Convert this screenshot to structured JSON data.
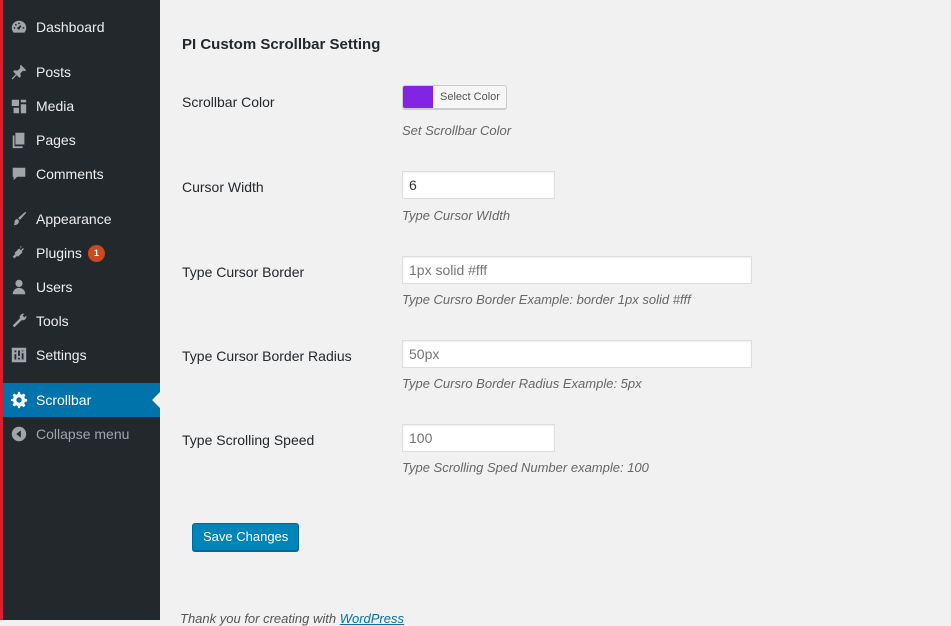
{
  "sidebar": {
    "items": [
      {
        "label": "Dashboard",
        "icon": "dashboard-icon"
      },
      {
        "label": "Posts",
        "icon": "pin-icon"
      },
      {
        "label": "Media",
        "icon": "media-icon"
      },
      {
        "label": "Pages",
        "icon": "pages-icon"
      },
      {
        "label": "Comments",
        "icon": "comment-icon"
      },
      {
        "label": "Appearance",
        "icon": "paintbrush-icon"
      },
      {
        "label": "Plugins",
        "icon": "plug-icon",
        "badge": "1"
      },
      {
        "label": "Users",
        "icon": "user-icon"
      },
      {
        "label": "Tools",
        "icon": "wrench-icon"
      },
      {
        "label": "Settings",
        "icon": "sliders-icon"
      },
      {
        "label": "Scrollbar",
        "icon": "gear-icon",
        "active": true
      },
      {
        "label": "Collapse menu",
        "icon": "collapse-arrow-icon"
      }
    ]
  },
  "page": {
    "title": "PI Custom Scrollbar Setting",
    "fields": {
      "color": {
        "label": "Scrollbar Color",
        "button_label": "Select Color",
        "value": "#8224e3",
        "description": "Set Scrollbar Color"
      },
      "width": {
        "label": "Cursor Width",
        "value": "6",
        "description": "Type Cursor WIdth"
      },
      "border": {
        "label": "Type Cursor Border",
        "placeholder": "1px solid #fff",
        "description": "Type Cursro Border Example: border 1px solid #fff"
      },
      "radius": {
        "label": "Type Cursor Border Radius",
        "placeholder": "50px",
        "description": "Type Cursro Border Radius Example: 5px"
      },
      "speed": {
        "label": "Type Scrolling Speed",
        "placeholder": "100",
        "description": "Type Scrolling Sped Number example: 100"
      }
    },
    "save_label": "Save Changes",
    "footer_text": "Thank you for creating with ",
    "footer_link": "WordPress"
  },
  "colors": {
    "sidebar_bg": "#23282d",
    "active_bg": "#0073aa",
    "primary_button": "#0085ba",
    "badge": "#ca4a1f"
  }
}
